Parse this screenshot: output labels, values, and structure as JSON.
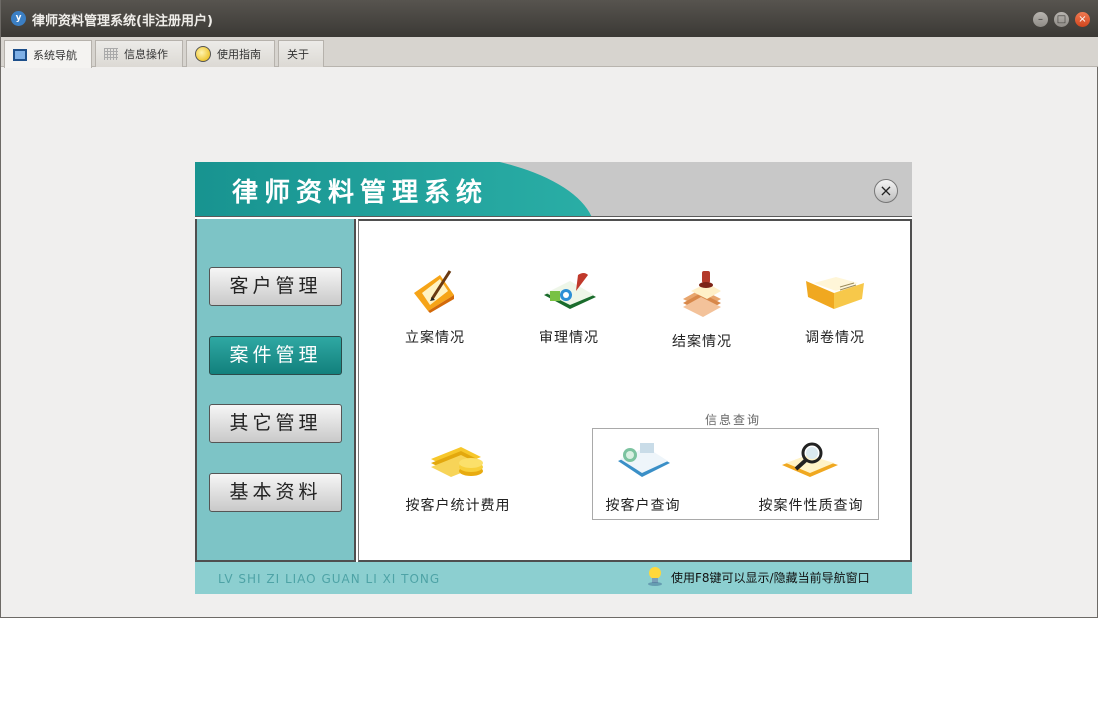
{
  "window": {
    "title": "律师资料管理系统(非注册用户)",
    "icon_letter": "y",
    "controls": {
      "minimize": "–",
      "maximize": "□",
      "close": "×"
    }
  },
  "tabs": [
    {
      "label": "系统导航",
      "icon": "monitor-icon",
      "active": true
    },
    {
      "label": "信息操作",
      "icon": "grid-icon",
      "active": false
    },
    {
      "label": "使用指南",
      "icon": "help-icon",
      "active": false
    },
    {
      "label": "关于",
      "icon": "",
      "active": false
    }
  ],
  "panel": {
    "title": "律师资料管理系统",
    "close_symbol": "×"
  },
  "sidebar": {
    "items": [
      {
        "label": "客户管理",
        "active": false
      },
      {
        "label": "案件管理",
        "active": true
      },
      {
        "label": "其它管理",
        "active": false
      },
      {
        "label": "基本资料",
        "active": false
      }
    ]
  },
  "content": {
    "items": [
      {
        "label": "立案情况",
        "icon": "filing-pencil-icon"
      },
      {
        "label": "审理情况",
        "icon": "trial-book-icon"
      },
      {
        "label": "结案情况",
        "icon": "closed-case-stamp-icon"
      },
      {
        "label": "调卷情况",
        "icon": "folder-open-icon"
      },
      {
        "label": "按客户统计费用",
        "icon": "coins-icon"
      },
      {
        "label": "按客户查询",
        "icon": "client-query-icon"
      },
      {
        "label": "按案件性质查询",
        "icon": "magnifier-icon"
      }
    ],
    "query_group_title": "信息查询"
  },
  "footer": {
    "pinyin": "LV SHI ZI LIAO GUAN LI XI TONG",
    "tip": "使用F8键可以显示/隐藏当前导航窗口"
  },
  "colors": {
    "teal": "#17928f",
    "sidebar": "#7dc4c6",
    "footer": "#8ccfd0",
    "titlebar": "#3b3935"
  }
}
